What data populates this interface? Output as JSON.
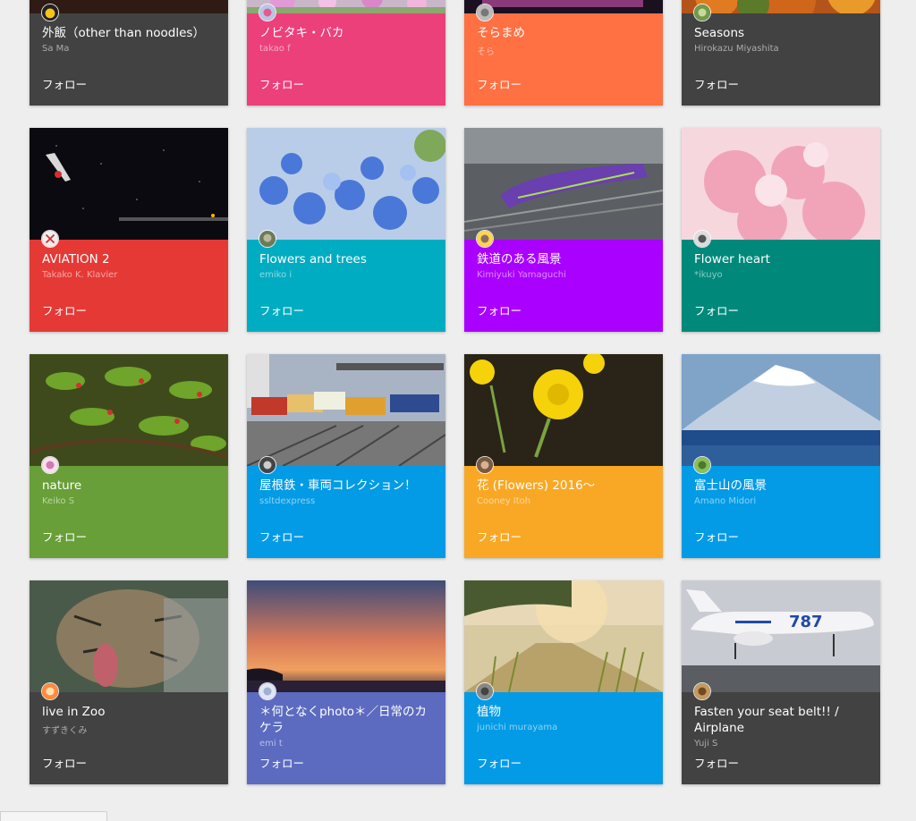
{
  "follow_label": "フォロー",
  "cards": [
    {
      "title": "外飯（other than noodles）",
      "author": "Sa Ma",
      "color": "#424242"
    },
    {
      "title": "ノビタキ・バカ",
      "author": "takao f",
      "color": "#ec407a"
    },
    {
      "title": "そらまめ",
      "author": "そら",
      "color": "#ff7043"
    },
    {
      "title": "Seasons",
      "author": "Hirokazu Miyashita",
      "color": "#424242"
    },
    {
      "title": "AVIATION 2",
      "author": "Takako K. Klavier",
      "color": "#e53935"
    },
    {
      "title": "Flowers and trees",
      "author": "emiko i",
      "color": "#00acc1"
    },
    {
      "title": "鉄道のある風景",
      "author": "Kimiyuki Yamaguchi",
      "color": "#aa00ff"
    },
    {
      "title": "Flower heart",
      "author": "*ikuyo",
      "color": "#00897b"
    },
    {
      "title": "nature",
      "author": "Keiko S",
      "color": "#689f38"
    },
    {
      "title": "屋根鉄・車両コレクション！",
      "author": "ssltdexpress",
      "color": "#039be5"
    },
    {
      "title": "花 (Flowers) 2016〜",
      "author": "Cooney Itoh",
      "color": "#f9a825"
    },
    {
      "title": "富士山の風景",
      "author": "Amano Midori",
      "color": "#039be5"
    },
    {
      "title": "live in Zoo",
      "author": "すずきくみ",
      "color": "#424242"
    },
    {
      "title": "＊何となくphoto＊／日常のカケラ",
      "author": "emi t",
      "color": "#5c6bc0"
    },
    {
      "title": "植物",
      "author": "junichi murayama",
      "color": "#039be5"
    },
    {
      "title": "Fasten your seat belt!! / Airplane",
      "author": "Yuji S",
      "color": "#424242"
    }
  ]
}
